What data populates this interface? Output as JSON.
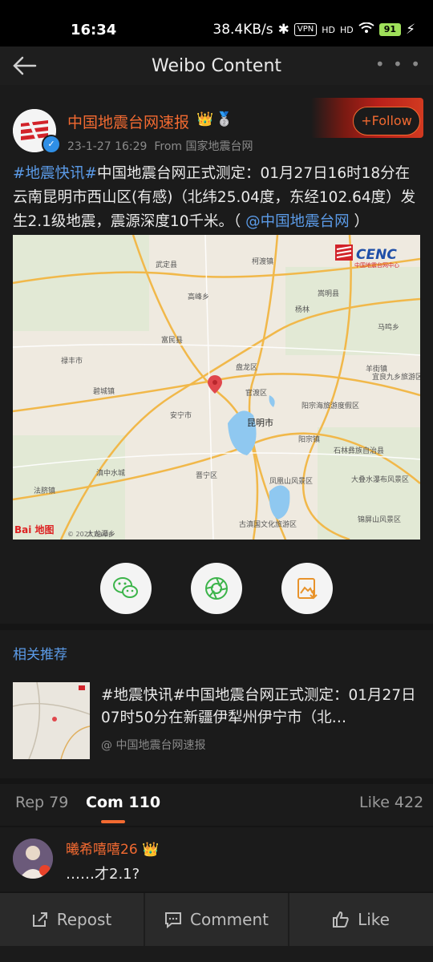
{
  "status": {
    "time": "16:34",
    "speed": "38.4KB/s",
    "bluetooth": "✱",
    "vpn": "VPN",
    "hd": "HD",
    "battery": "91",
    "charge": "⚡"
  },
  "nav": {
    "title": "Weibo Content",
    "back_icon": "back-arrow-icon",
    "more": "• • •"
  },
  "post": {
    "username": "中国地震台网速报",
    "crown": "👑",
    "medal": "🥈",
    "time": "23-1-27 16:29",
    "source": "From 国家地震台网",
    "follow_label": "+Follow",
    "tag": "#地震快讯#",
    "text": "中国地震台网正式测定：01月27日16时18分在云南昆明市西山区(有感)（北纬25.04度，东经102.64度）发生2.1级地震，震源深度10千米。（ ",
    "mention": "@中国地震台网",
    "text_end": " ）"
  },
  "map": {
    "logo": "CENC",
    "logo_sub": "中国地震台网中心",
    "copyright": "© 2023 Baidu",
    "baidu": "Bai 地图",
    "labels": [
      "武定县",
      "柯渡镇",
      "羊街镇",
      "马鸣乡",
      "富民县",
      "高峰乡",
      "禄丰市",
      "碧城镇",
      "盘龙区",
      "宜良九乡旅游区",
      "安宁市",
      "官渡区",
      "昆明市",
      "阳宗海旅游度假区",
      "石林彝族自治县",
      "晋宁区",
      "大叠水瀑布风景区",
      "法脐镇",
      "古滇国文化旅游区",
      "锦屏山风景区",
      "滇中水城",
      "凤凰山风景区",
      "大龙潭乡",
      "阳宗镇",
      "杨林",
      "嵩明县"
    ]
  },
  "share": {
    "wechat": "wechat-icon",
    "moments": "moments-icon",
    "save": "save-image-icon"
  },
  "recommend": {
    "title": "相关推荐",
    "tag": "#地震快讯#",
    "text": "中国地震台网正式测定：01月27日07时50分在新疆伊犁州伊宁市（北…",
    "source": "@ 中国地震台网速报"
  },
  "tabs": {
    "rep": "Rep 79",
    "com": "Com 110",
    "like": "Like 422"
  },
  "comment": {
    "username": "曦希嘻嘻26",
    "badge": "👑",
    "text": "……才2.1?"
  },
  "bottom": {
    "repost": "Repost",
    "comment": "Comment",
    "like": "Like"
  },
  "colors": {
    "accent": "#f26a31",
    "link": "#5b9be8",
    "bg": "#151515"
  }
}
